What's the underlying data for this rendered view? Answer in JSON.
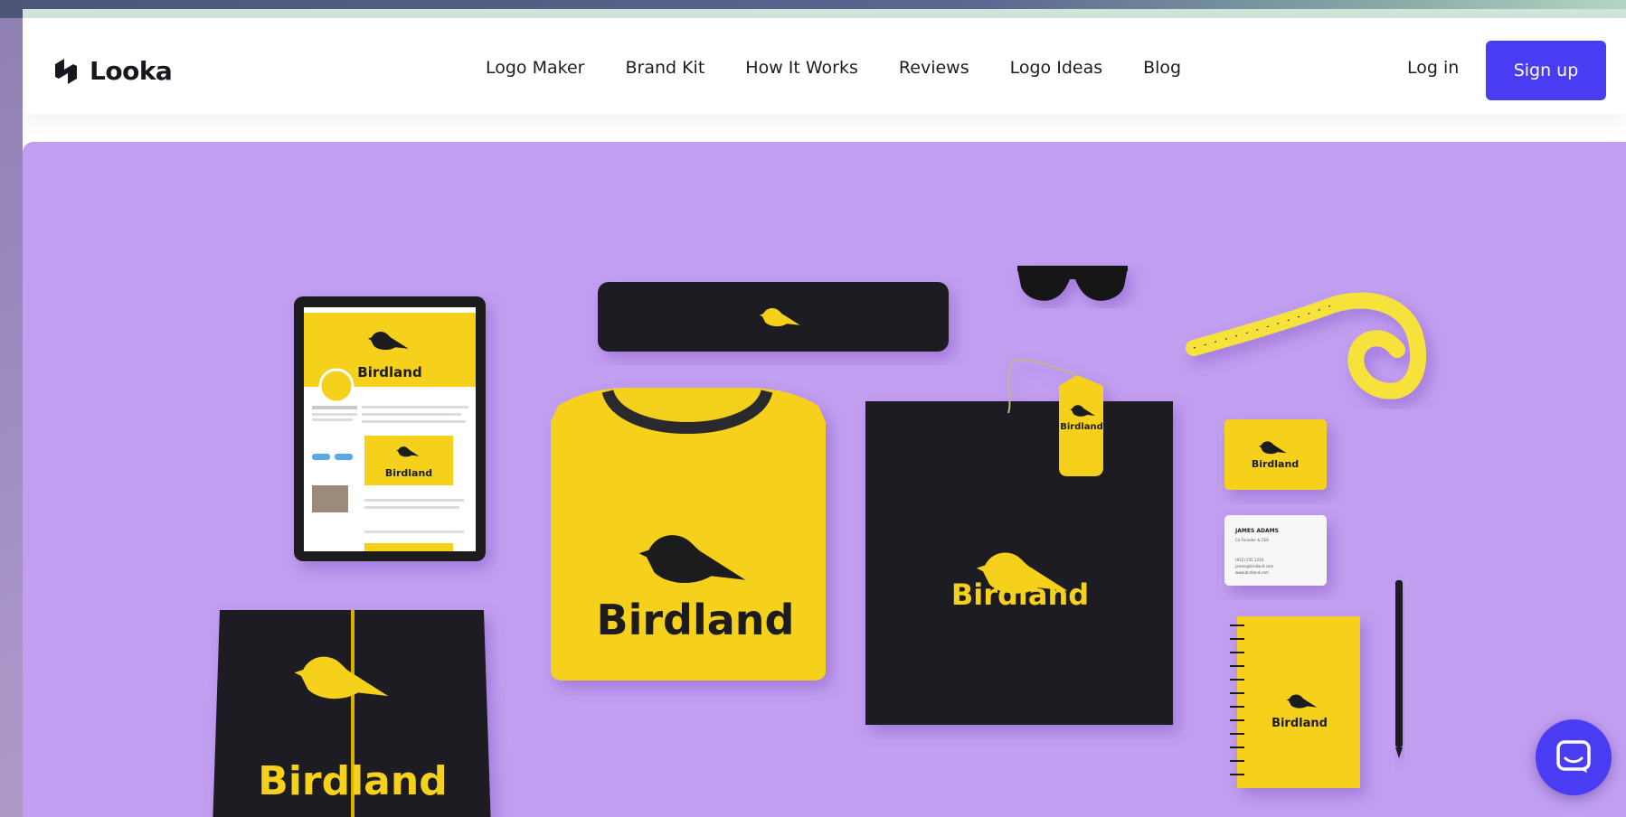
{
  "brand": {
    "name": "Looka",
    "accent": "#4a3cf2"
  },
  "nav": {
    "items": [
      {
        "label": "Logo Maker"
      },
      {
        "label": "Brand Kit"
      },
      {
        "label": "How It Works"
      },
      {
        "label": "Reviews"
      },
      {
        "label": "Logo Ideas"
      },
      {
        "label": "Blog"
      }
    ]
  },
  "auth": {
    "login_label": "Log in",
    "signup_label": "Sign up"
  },
  "hero": {
    "background": "#c19ef0",
    "brand_yellow": "#f6d11c",
    "mockup_brand": "Birdland",
    "business_card_name": "JAMES ADAMS",
    "business_card_title": "Co-Founder & CEO",
    "business_card_phone": "(912) 555 1234",
    "business_card_email": "james@birdland.com",
    "business_card_web": "www.birdland.com"
  },
  "chat": {
    "icon": "chat-bubble-icon"
  }
}
